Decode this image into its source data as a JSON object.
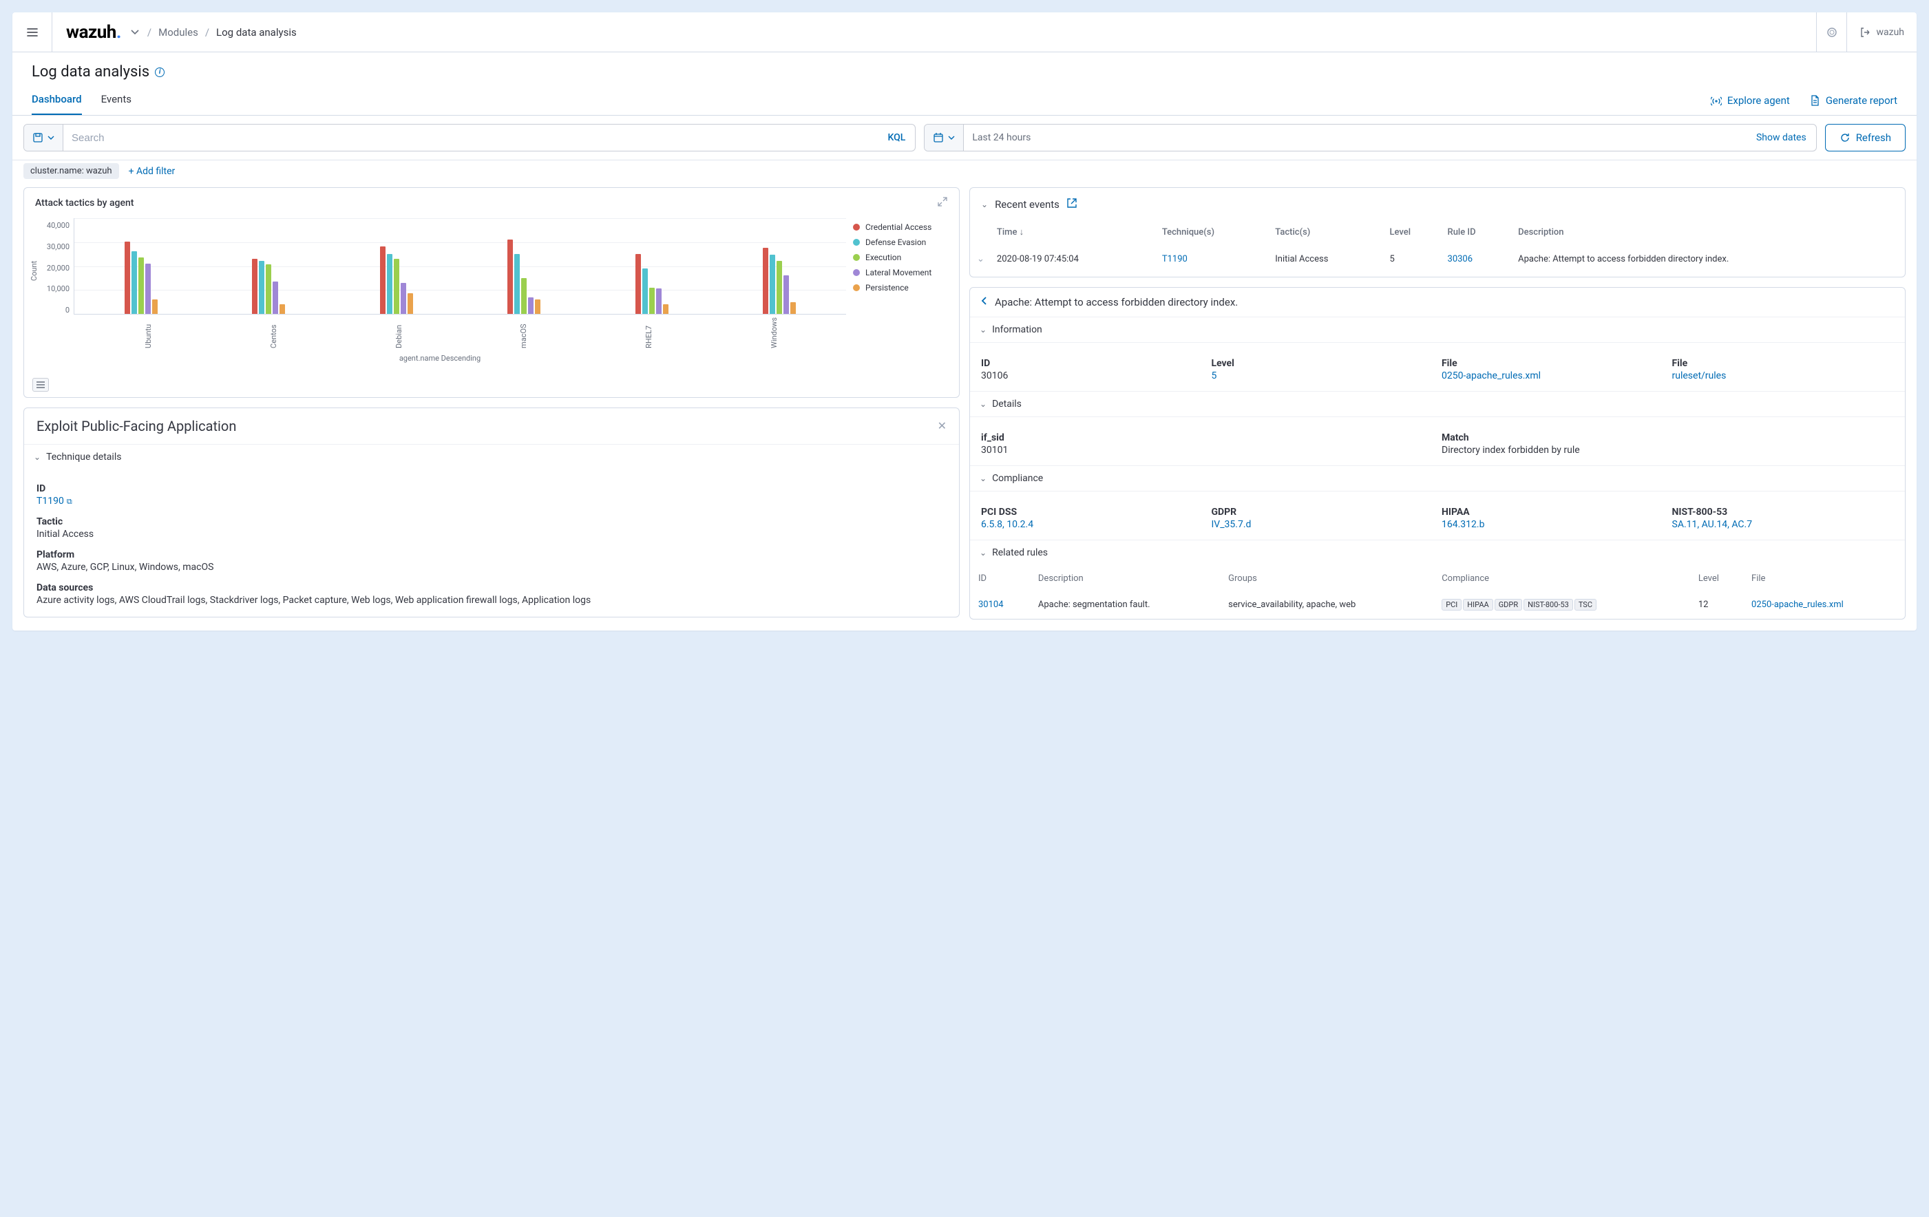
{
  "brand": {
    "name": "wazuh",
    "tenant": "wazuh"
  },
  "breadcrumb": {
    "root_icon": "chevron-down",
    "modules": "Modules",
    "current": "Log data analysis"
  },
  "page": {
    "title": "Log data analysis"
  },
  "tabs": {
    "dashboard": "Dashboard",
    "events": "Events"
  },
  "actions": {
    "explore_agent": "Explore agent",
    "generate_report": "Generate report"
  },
  "search": {
    "placeholder": "Search",
    "kql": "KQL"
  },
  "daterange": {
    "value": "Last 24 hours",
    "show_dates": "Show dates",
    "refresh": "Refresh"
  },
  "filters": {
    "chip": "cluster.name: wazuh",
    "add": "+ Add filter"
  },
  "chart_data": {
    "type": "bar",
    "title": "Attack tactics by agent",
    "ylabel": "Count",
    "xlabel": "agent.name Descending",
    "ylim": [
      0,
      40000
    ],
    "yticks": [
      "40,000",
      "30,000",
      "20,000",
      "10,000",
      "0"
    ],
    "categories": [
      "Ubuntu",
      "Centos",
      "Debian",
      "macOS",
      "RHEL7",
      "Windows"
    ],
    "series": [
      {
        "name": "Credential Access",
        "color": "#d6564c",
        "values": [
          30000,
          23000,
          28000,
          31000,
          25000,
          27500
        ]
      },
      {
        "name": "Defense Evasion",
        "color": "#51c2cf",
        "values": [
          26000,
          22000,
          25000,
          25000,
          19000,
          24500
        ]
      },
      {
        "name": "Execution",
        "color": "#9bcf4e",
        "values": [
          23500,
          20500,
          23000,
          15000,
          11000,
          22000
        ]
      },
      {
        "name": "Lateral Movement",
        "color": "#9f87d6",
        "values": [
          21000,
          13500,
          13000,
          7000,
          10500,
          16000
        ]
      },
      {
        "name": "Persistence",
        "color": "#eaa24c",
        "values": [
          6000,
          4000,
          8500,
          6000,
          4000,
          5000
        ]
      }
    ]
  },
  "exploit_panel": {
    "title": "Exploit Public-Facing Application",
    "section": "Technique details",
    "id_label": "ID",
    "id_value": "T1190",
    "tactic_label": "Tactic",
    "tactic_value": "Initial Access",
    "platform_label": "Platform",
    "platform_value": "AWS, Azure, GCP, Linux, Windows, macOS",
    "data_sources_label": "Data sources",
    "data_sources_value": "Azure activity logs, AWS CloudTrail logs, Stackdriver logs, Packet capture, Web logs, Web application firewall logs, Application logs"
  },
  "recent": {
    "title": "Recent events",
    "headers": {
      "time": "Time",
      "technique": "Technique(s)",
      "tactic": "Tactic(s)",
      "level": "Level",
      "rule_id": "Rule ID",
      "description": "Description"
    },
    "row": {
      "time": "2020-08-19 07:45:04",
      "technique": "T1190",
      "tactic": "Initial Access",
      "level": "5",
      "rule_id": "30306",
      "description": "Apache: Attempt to access forbidden directory index."
    }
  },
  "detail": {
    "title": "Apache: Attempt to access forbidden directory index.",
    "sections": {
      "information": "Information",
      "details": "Details",
      "compliance": "Compliance",
      "related": "Related rules"
    },
    "info": {
      "id_label": "ID",
      "id_value": "30106",
      "level_label": "Level",
      "level_value": "5",
      "file_label": "File",
      "file_value": "0250-apache_rules.xml",
      "path_label": "File",
      "path_value": "ruleset/rules"
    },
    "details": {
      "if_sid_label": "if_sid",
      "if_sid_value": "30101",
      "match_label": "Match",
      "match_value": "Directory index forbidden by rule"
    },
    "compliance": {
      "pci_label": "PCI DSS",
      "pci_value": "6.5.8, 10.2.4",
      "gdpr_label": "GDPR",
      "gdpr_value": "IV_35.7.d",
      "hipaa_label": "HIPAA",
      "hipaa_value": "164.312.b",
      "nist_label": "NIST-800-53",
      "nist_value": "SA.11, AU.14, AC.7"
    },
    "related": {
      "headers": {
        "id": "ID",
        "description": "Description",
        "groups": "Groups",
        "compliance": "Compliance",
        "level": "Level",
        "file": "File"
      },
      "row": {
        "id": "30104",
        "description": "Apache: segmentation fault.",
        "groups": "service_availability, apache, web",
        "badges": [
          "PCI",
          "HIPAA",
          "GDPR",
          "NIST-800-53",
          "TSC"
        ],
        "level": "12",
        "file": "0250-apache_rules.xml"
      }
    }
  }
}
